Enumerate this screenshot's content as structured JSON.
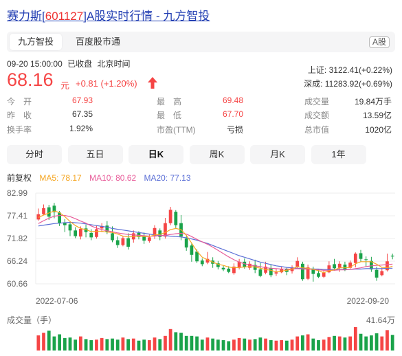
{
  "title": {
    "name": "赛力斯",
    "code": "601127",
    "rest": "A股实时行情 - 九方智投"
  },
  "tabs": [
    {
      "label": "九方智投",
      "active": true
    },
    {
      "label": "百度股市通",
      "active": false
    }
  ],
  "market_badge": "A股",
  "quote": {
    "datetime": "09-20 15:00:00",
    "status": "已收盘",
    "timezone": "北京时间",
    "price": "68.16",
    "unit": "元",
    "change": "+0.81 (+1.20%)"
  },
  "indices": [
    {
      "text": "上证: 3122.41(+0.22%)"
    },
    {
      "text": "深成: 11283.92(+0.69%)"
    }
  ],
  "stats": {
    "col1": [
      {
        "label": "今　开",
        "value": "67.93",
        "color": "red"
      },
      {
        "label": "昨　收",
        "value": "67.35",
        "color": "normal"
      },
      {
        "label": "换手率",
        "value": "1.92%",
        "color": "normal"
      }
    ],
    "col2": [
      {
        "label": "最　高",
        "value": "69.48",
        "color": "red"
      },
      {
        "label": "最　低",
        "value": "67.70",
        "color": "red"
      },
      {
        "label": "市盈(TTM)",
        "value": "亏损",
        "color": "normal"
      }
    ],
    "col3": [
      {
        "label": "成交量",
        "value": "19.84万手",
        "color": "normal"
      },
      {
        "label": "成交额",
        "value": "13.59亿",
        "color": "normal"
      },
      {
        "label": "总市值",
        "value": "1020亿",
        "color": "normal"
      }
    ]
  },
  "periods": [
    {
      "label": "分时",
      "active": false
    },
    {
      "label": "五日",
      "active": false
    },
    {
      "label": "日K",
      "active": true
    },
    {
      "label": "周K",
      "active": false
    },
    {
      "label": "月K",
      "active": false
    },
    {
      "label": "1年",
      "active": false
    }
  ],
  "ma_legend": {
    "adjust": "前复权",
    "ma5": {
      "label": "MA5: 78.17",
      "color": "#f5a623"
    },
    "ma10": {
      "label": "MA10: 80.62",
      "color": "#e85d9a"
    },
    "ma20": {
      "label": "MA20: 77.13",
      "color": "#5b6fd6"
    }
  },
  "volume_header": {
    "label": "成交量（手）",
    "max": "41.64万"
  },
  "colors": {
    "up": "#f54545",
    "down": "#1aa34a",
    "accent": "#2440b3"
  },
  "chart_data": {
    "type": "candlestick",
    "y_ticks": [
      "82.99",
      "77.41",
      "71.82",
      "66.24",
      "60.66"
    ],
    "ylim": [
      60.66,
      82.99
    ],
    "x_labels": [
      "2022-07-06",
      "2022-09-20"
    ],
    "candles": [
      [
        76.5,
        77.8,
        79.2,
        76.2
      ],
      [
        77.8,
        79.3,
        80.2,
        77.6
      ],
      [
        79.5,
        77.2,
        80.1,
        76.4
      ],
      [
        79.9,
        78.3,
        80.6,
        76.8
      ],
      [
        78.2,
        75.6,
        78.6,
        74.9
      ],
      [
        75.8,
        75.1,
        76.6,
        73.4
      ],
      [
        75.3,
        73.8,
        75.9,
        72.4
      ],
      [
        73.8,
        72.4,
        74.6,
        71.9
      ],
      [
        72.3,
        74.2,
        74.8,
        71.6
      ],
      [
        74.3,
        73.4,
        75.2,
        72.1
      ],
      [
        73.2,
        72.1,
        74.1,
        71.4
      ],
      [
        72.2,
        74.1,
        75.0,
        71.8
      ],
      [
        74.3,
        74.9,
        75.6,
        73.4
      ],
      [
        75.0,
        73.5,
        76.1,
        72.9
      ],
      [
        73.1,
        71.4,
        74.8,
        70.9
      ],
      [
        71.4,
        70.2,
        72.3,
        69.5
      ],
      [
        70.2,
        71.9,
        72.4,
        69.9
      ],
      [
        71.9,
        69.8,
        73.1,
        69.1
      ],
      [
        71.6,
        73.1,
        73.8,
        70.8
      ],
      [
        73.2,
        72.2,
        73.6,
        71.6
      ],
      [
        72.5,
        71.3,
        73.3,
        70.5
      ],
      [
        71.2,
        72.1,
        72.8,
        70.8
      ],
      [
        72.4,
        74.4,
        75.1,
        71.7
      ],
      [
        73.8,
        72.2,
        74.3,
        71.4
      ],
      [
        72.3,
        75.6,
        76.9,
        71.8
      ],
      [
        75.6,
        78.9,
        79.6,
        75.1
      ],
      [
        78.4,
        75.1,
        78.8,
        74.4
      ],
      [
        75.6,
        72.3,
        77.6,
        71.4
      ],
      [
        71.8,
        69.6,
        72.4,
        68.8
      ],
      [
        70.1,
        67.8,
        70.6,
        66.1
      ],
      [
        68.6,
        66.2,
        69.1,
        65.8
      ],
      [
        66.4,
        65.5,
        66.9,
        65.0
      ],
      [
        65.9,
        66.8,
        68.5,
        65.5
      ],
      [
        66.4,
        65.6,
        67.2,
        64.6
      ],
      [
        65.7,
        64.8,
        66.3,
        64.2
      ],
      [
        64.6,
        64.2,
        65.1,
        63.8
      ],
      [
        64.4,
        63.6,
        65.0,
        63.3
      ],
      [
        63.3,
        64.9,
        65.7,
        62.9
      ],
      [
        64.6,
        66.1,
        66.8,
        64.2
      ],
      [
        66.1,
        64.8,
        66.9,
        64.4
      ],
      [
        64.6,
        65.6,
        66.2,
        64.1
      ],
      [
        65.3,
        64.1,
        66.6,
        63.3
      ],
      [
        64.2,
        62.6,
        65.8,
        62.3
      ],
      [
        63.4,
        64.9,
        66.1,
        63.0
      ],
      [
        64.5,
        62.8,
        65.4,
        62.3
      ],
      [
        63.2,
        63.5,
        64.3,
        62.6
      ],
      [
        63.5,
        64.3,
        64.9,
        63.3
      ],
      [
        64.4,
        63.6,
        64.6,
        62.8
      ],
      [
        63.8,
        64.7,
        65.2,
        63.2
      ],
      [
        64.9,
        66.3,
        67.2,
        64.5
      ],
      [
        65.6,
        61.8,
        66.1,
        61.4
      ],
      [
        61.9,
        64.7,
        65.4,
        61.6
      ],
      [
        64.4,
        63.1,
        64.9,
        61.2
      ],
      [
        63.3,
        62.4,
        64.3,
        62.1
      ],
      [
        62.4,
        63.4,
        64.0,
        62.1
      ],
      [
        63.5,
        65.2,
        66.2,
        63.3
      ],
      [
        65.5,
        64.5,
        66.8,
        63.9
      ],
      [
        64.6,
        65.6,
        66.2,
        63.6
      ],
      [
        65.4,
        64.2,
        66.1,
        63.8
      ],
      [
        64.6,
        65.9,
        66.4,
        64.4
      ],
      [
        65.8,
        68.1,
        68.4,
        64.7
      ],
      [
        68.2,
        66.8,
        69.0,
        66.1
      ],
      [
        66.7,
        66.6,
        67.4,
        64.8
      ],
      [
        66.3,
        64.2,
        67.3,
        63.6
      ],
      [
        64.1,
        62.2,
        64.9,
        61.4
      ],
      [
        62.8,
        63.8,
        64.6,
        62.5
      ],
      [
        64.0,
        66.2,
        68.1,
        63.7
      ],
      [
        67.6,
        67.4,
        68.1,
        66.7
      ]
    ],
    "ma5": [
      77.0,
      77.6,
      78.1,
      78.6,
      78.2,
      77.2,
      76.0,
      75.0,
      74.3,
      74.0,
      73.5,
      73.6,
      73.6,
      73.4,
      73.3,
      72.9,
      72.4,
      72.2,
      72.3,
      72.4,
      72.3,
      72.3,
      72.7,
      72.8,
      73.3,
      74.0,
      74.3,
      74.0,
      72.6,
      70.7,
      68.7,
      67.2,
      66.6,
      66.0,
      65.5,
      65.2,
      64.8,
      64.6,
      64.7,
      64.8,
      64.9,
      64.8,
      64.5,
      64.2,
      64.0,
      63.6,
      63.8,
      64.0,
      64.3,
      64.9,
      64.6,
      64.5,
      64.2,
      63.9,
      63.4,
      63.9,
      64.1,
      64.6,
      64.6,
      64.7,
      65.6,
      66.1,
      66.1,
      66.1,
      65.5,
      64.7,
      64.6,
      65.0
    ],
    "ma10": [
      75.5,
      76.2,
      76.8,
      77.3,
      77.5,
      77.5,
      77.2,
      76.7,
      76.1,
      75.6,
      74.9,
      74.4,
      74.0,
      73.7,
      73.5,
      73.2,
      73.0,
      72.8,
      72.7,
      72.6,
      72.5,
      72.4,
      72.4,
      72.5,
      72.6,
      72.8,
      73.0,
      73.1,
      72.9,
      72.3,
      71.6,
      71.0,
      70.4,
      69.7,
      68.9,
      68.1,
      67.3,
      66.6,
      66.0,
      65.6,
      65.3,
      65.1,
      64.9,
      64.6,
      64.5,
      64.4,
      64.3,
      64.3,
      64.3,
      64.4,
      64.3,
      64.3,
      64.2,
      64.1,
      64.0,
      64.0,
      64.0,
      64.1,
      64.1,
      64.2,
      64.4,
      64.6,
      64.9,
      65.1,
      65.2,
      65.3,
      65.4,
      65.5
    ],
    "ma20": [
      74.9,
      75.1,
      75.3,
      75.5,
      75.6,
      75.7,
      75.8,
      75.7,
      75.6,
      75.4,
      75.2,
      75.0,
      74.8,
      74.6,
      74.3,
      74.1,
      73.9,
      73.7,
      73.5,
      73.3,
      73.1,
      72.9,
      72.7,
      72.6,
      72.5,
      72.4,
      72.3,
      72.2,
      72.0,
      71.7,
      71.4,
      71.0,
      70.6,
      70.1,
      69.6,
      69.1,
      68.6,
      68.1,
      67.6,
      67.2,
      66.8,
      66.4,
      66.0,
      65.7,
      65.4,
      65.1,
      64.9,
      64.7,
      64.6,
      64.5,
      64.4,
      64.4,
      64.3,
      64.3,
      64.2,
      64.2,
      64.2,
      64.2,
      64.2,
      64.2,
      64.3,
      64.3,
      64.4,
      64.4,
      64.4,
      64.4,
      64.5,
      64.5
    ],
    "volume": [
      26,
      31,
      35,
      24,
      28,
      21,
      22,
      18,
      24,
      19,
      17,
      18,
      21,
      19,
      20,
      18,
      22,
      19,
      20,
      16,
      18,
      17,
      22,
      19,
      25,
      38,
      32,
      31,
      25,
      25,
      24,
      18,
      22,
      20,
      18,
      17,
      15,
      18,
      21,
      20,
      18,
      19,
      22,
      20,
      17,
      16,
      17,
      16,
      18,
      24,
      26,
      28,
      20,
      17,
      18,
      23,
      25,
      24,
      22,
      24,
      41.64,
      29,
      24,
      26,
      30,
      24,
      36,
      27
    ]
  }
}
